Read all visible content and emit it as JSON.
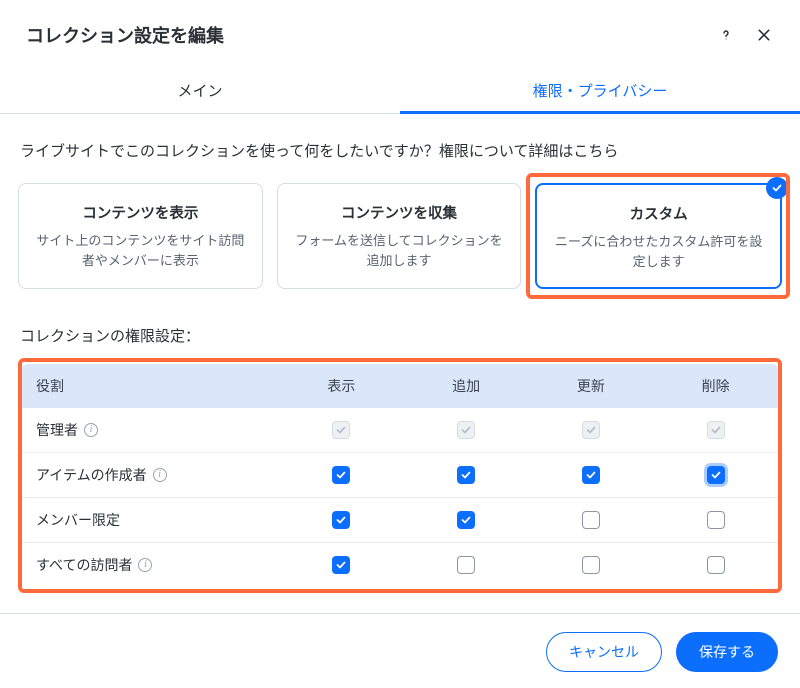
{
  "header": {
    "title": "コレクション設定を編集"
  },
  "tabs": {
    "main": "メイン",
    "privacy": "権限・プライバシー"
  },
  "prompt": {
    "text": "ライブサイトでこのコレクションを使って何をしたいですか？",
    "link": "権限について詳細はこちら"
  },
  "cards": [
    {
      "title": "コンテンツを表示",
      "desc": "サイト上のコンテンツをサイト訪問者やメンバーに表示",
      "selected": false
    },
    {
      "title": "コンテンツを収集",
      "desc": "フォームを送信してコレクションを追加します",
      "selected": false
    },
    {
      "title": "カスタム",
      "desc": "ニーズに合わせたカスタム許可を設定します",
      "selected": true
    }
  ],
  "perm_section_title": "コレクションの権限設定：",
  "perm_table": {
    "headers": {
      "role": "役割",
      "view": "表示",
      "add": "追加",
      "update": "更新",
      "delete": "削除"
    },
    "rows": [
      {
        "role": "管理者",
        "info": true,
        "cells": [
          "disabled-checked",
          "disabled-checked",
          "disabled-checked",
          "disabled-checked"
        ]
      },
      {
        "role": "アイテムの作成者",
        "info": true,
        "cells": [
          "checked",
          "checked",
          "checked",
          "checked-focus"
        ]
      },
      {
        "role": "メンバー限定",
        "info": false,
        "cells": [
          "checked",
          "checked",
          "unchecked",
          "unchecked"
        ]
      },
      {
        "role": "すべての訪問者",
        "info": true,
        "cells": [
          "checked",
          "unchecked",
          "unchecked",
          "unchecked"
        ]
      }
    ]
  },
  "footer": {
    "cancel": "キャンセル",
    "save": "保存する"
  }
}
